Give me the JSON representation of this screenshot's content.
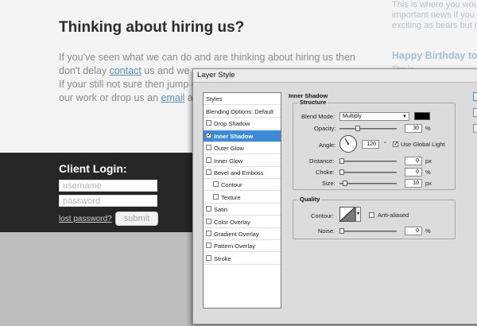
{
  "hero": {
    "title": "Thinking about hiring us?",
    "line1": "If you've seen what we can do and are thinking about hiring us then",
    "line2_pre": "don't delay ",
    "line2_link": "contact",
    "line2_post": " us and we ca",
    "line3": "If your still not sure then jump ov",
    "line4_pre": "our work or drop us an ",
    "line4_link": "email",
    "line4_post": " and"
  },
  "news": {
    "line1": "This is where you woul",
    "line2": "important news if you h",
    "line3": "exciting as bears but m",
    "title": "Happy Birthday to",
    "subtitle": "The lo"
  },
  "login": {
    "title": "Client Login:",
    "username_placeholder": "username",
    "password_placeholder": "password",
    "lost_password": "lost password?",
    "submit": "submit"
  },
  "dialog": {
    "title": "Layer Style",
    "styles_header": "Styles",
    "items": [
      {
        "label": "Blending Options: Default",
        "checkbox": false,
        "checked": false,
        "indent": false,
        "selected": false
      },
      {
        "label": "Drop Shadow",
        "checkbox": true,
        "checked": false,
        "indent": false,
        "selected": false
      },
      {
        "label": "Inner Shadow",
        "checkbox": true,
        "checked": true,
        "indent": false,
        "selected": true
      },
      {
        "label": "Outer Glow",
        "checkbox": true,
        "checked": false,
        "indent": false,
        "selected": false
      },
      {
        "label": "Inner Glow",
        "checkbox": true,
        "checked": false,
        "indent": false,
        "selected": false
      },
      {
        "label": "Bevel and Emboss",
        "checkbox": true,
        "checked": false,
        "indent": false,
        "selected": false
      },
      {
        "label": "Contour",
        "checkbox": true,
        "checked": false,
        "indent": true,
        "selected": false
      },
      {
        "label": "Texture",
        "checkbox": true,
        "checked": false,
        "indent": true,
        "selected": false
      },
      {
        "label": "Satin",
        "checkbox": true,
        "checked": false,
        "indent": false,
        "selected": false
      },
      {
        "label": "Color Overlay",
        "checkbox": true,
        "checked": false,
        "indent": false,
        "selected": false
      },
      {
        "label": "Gradient Overlay",
        "checkbox": true,
        "checked": false,
        "indent": false,
        "selected": false
      },
      {
        "label": "Pattern Overlay",
        "checkbox": true,
        "checked": false,
        "indent": false,
        "selected": false
      },
      {
        "label": "Stroke",
        "checkbox": true,
        "checked": false,
        "indent": false,
        "selected": false
      }
    ],
    "panel_title": "Inner Shadow",
    "structure": {
      "label": "Structure",
      "blend_mode_label": "Blend Mode:",
      "blend_mode_value": "Multiply",
      "shadow_color": "#000000",
      "opacity_label": "Opacity:",
      "opacity_value": "30",
      "opacity_unit": "%",
      "opacity_fraction": 0.3,
      "angle_label": "Angle:",
      "angle_value": "120",
      "angle_unit": "°",
      "angle_degrees": 120,
      "global_light_label": "Use Global Light",
      "global_light_checked": true,
      "distance_label": "Distance:",
      "distance_value": "0",
      "distance_unit": "px",
      "choke_label": "Choke:",
      "choke_value": "0",
      "choke_unit": "%",
      "size_label": "Size:",
      "size_value": "10",
      "size_unit": "px"
    },
    "quality": {
      "label": "Quality",
      "contour_label": "Contour:",
      "anti_aliased_label": "Anti-aliased",
      "anti_aliased_checked": false,
      "noise_label": "Noise:",
      "noise_value": "0",
      "noise_unit": "%"
    }
  }
}
